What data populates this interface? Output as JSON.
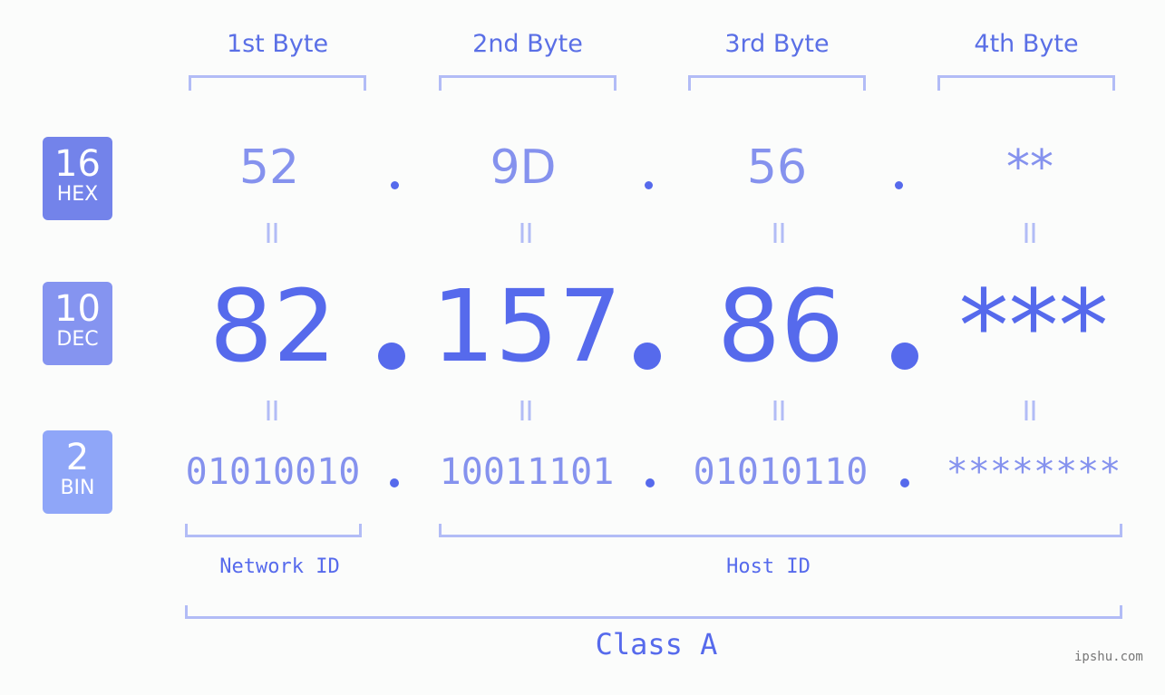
{
  "headers": [
    "1st Byte",
    "2nd Byte",
    "3rd Byte",
    "4th Byte"
  ],
  "badges": [
    {
      "number": "16",
      "label": "HEX",
      "color": "#7383ea"
    },
    {
      "number": "10",
      "label": "DEC",
      "color": "#8594f0"
    },
    {
      "number": "2",
      "label": "BIN",
      "color": "#8fa6f8"
    }
  ],
  "hex": [
    "52",
    "9D",
    "56",
    "**"
  ],
  "dec": [
    "82",
    "157",
    "86",
    "***"
  ],
  "bin": [
    "01010010",
    "10011101",
    "01010110",
    "********"
  ],
  "equals_glyph": "=",
  "network_label": "Network ID",
  "host_label": "Host ID",
  "class_label": "Class A",
  "watermark": "ipshu.com",
  "colors": {
    "accent": "#566aec",
    "light": "#8592ee",
    "bracket": "#b2bcf6"
  }
}
